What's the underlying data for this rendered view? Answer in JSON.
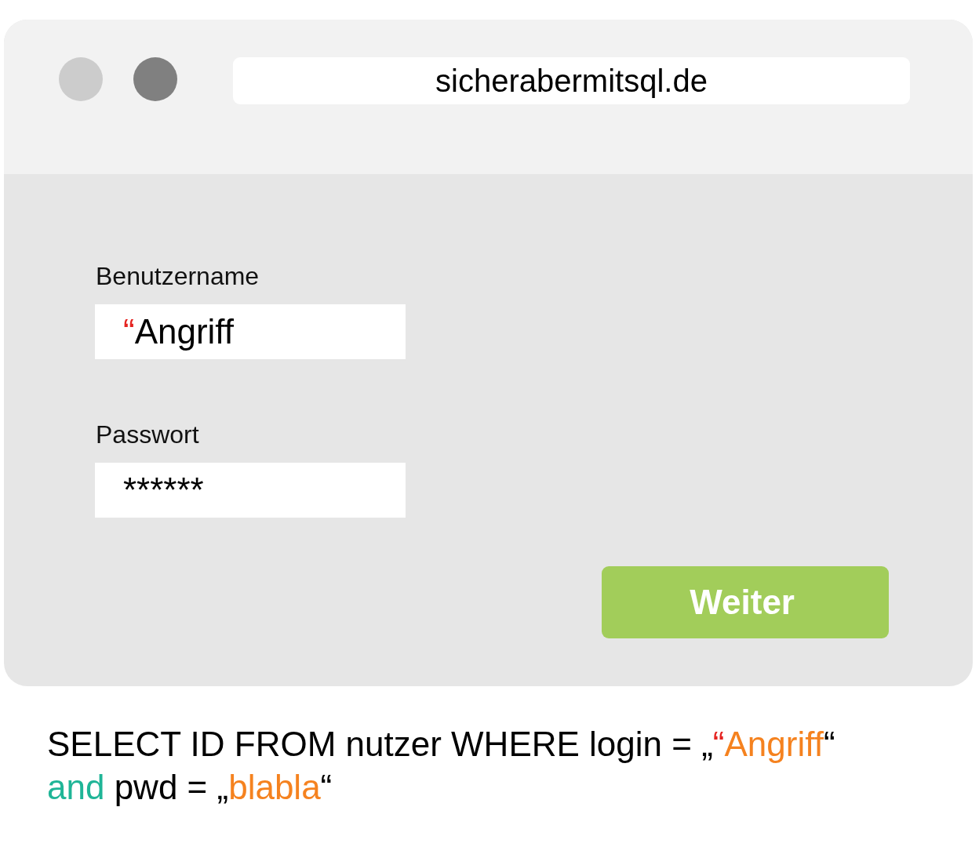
{
  "window": {
    "controls": [
      {
        "color": "#cccccc"
      },
      {
        "color": "#808080"
      }
    ],
    "address": "sicherabermitsql.de"
  },
  "form": {
    "fields": [
      {
        "label": "Benutzername",
        "value": [
          {
            "text": "“",
            "color": "#e52421"
          },
          {
            "text": "Angriff",
            "color": "#000000"
          }
        ]
      },
      {
        "label": "Passwort",
        "value": [
          {
            "text": "******",
            "color": "#000000"
          }
        ]
      }
    ],
    "submit": "Weiter"
  },
  "query": {
    "lines": [
      [
        {
          "text": "SELECT ID FROM nutzer WHERE login = „",
          "color": "#000000"
        },
        {
          "text": "“",
          "color": "#e52421"
        },
        {
          "text": "Angriff",
          "color": "#f5821f"
        },
        {
          "text": "“",
          "color": "#000000"
        }
      ],
      [
        {
          "text": "and",
          "color": "#1fb597"
        },
        {
          "text": " pwd = „",
          "color": "#000000"
        },
        {
          "text": "blabla",
          "color": "#f5821f"
        },
        {
          "text": "“",
          "color": "#000000"
        }
      ]
    ]
  }
}
